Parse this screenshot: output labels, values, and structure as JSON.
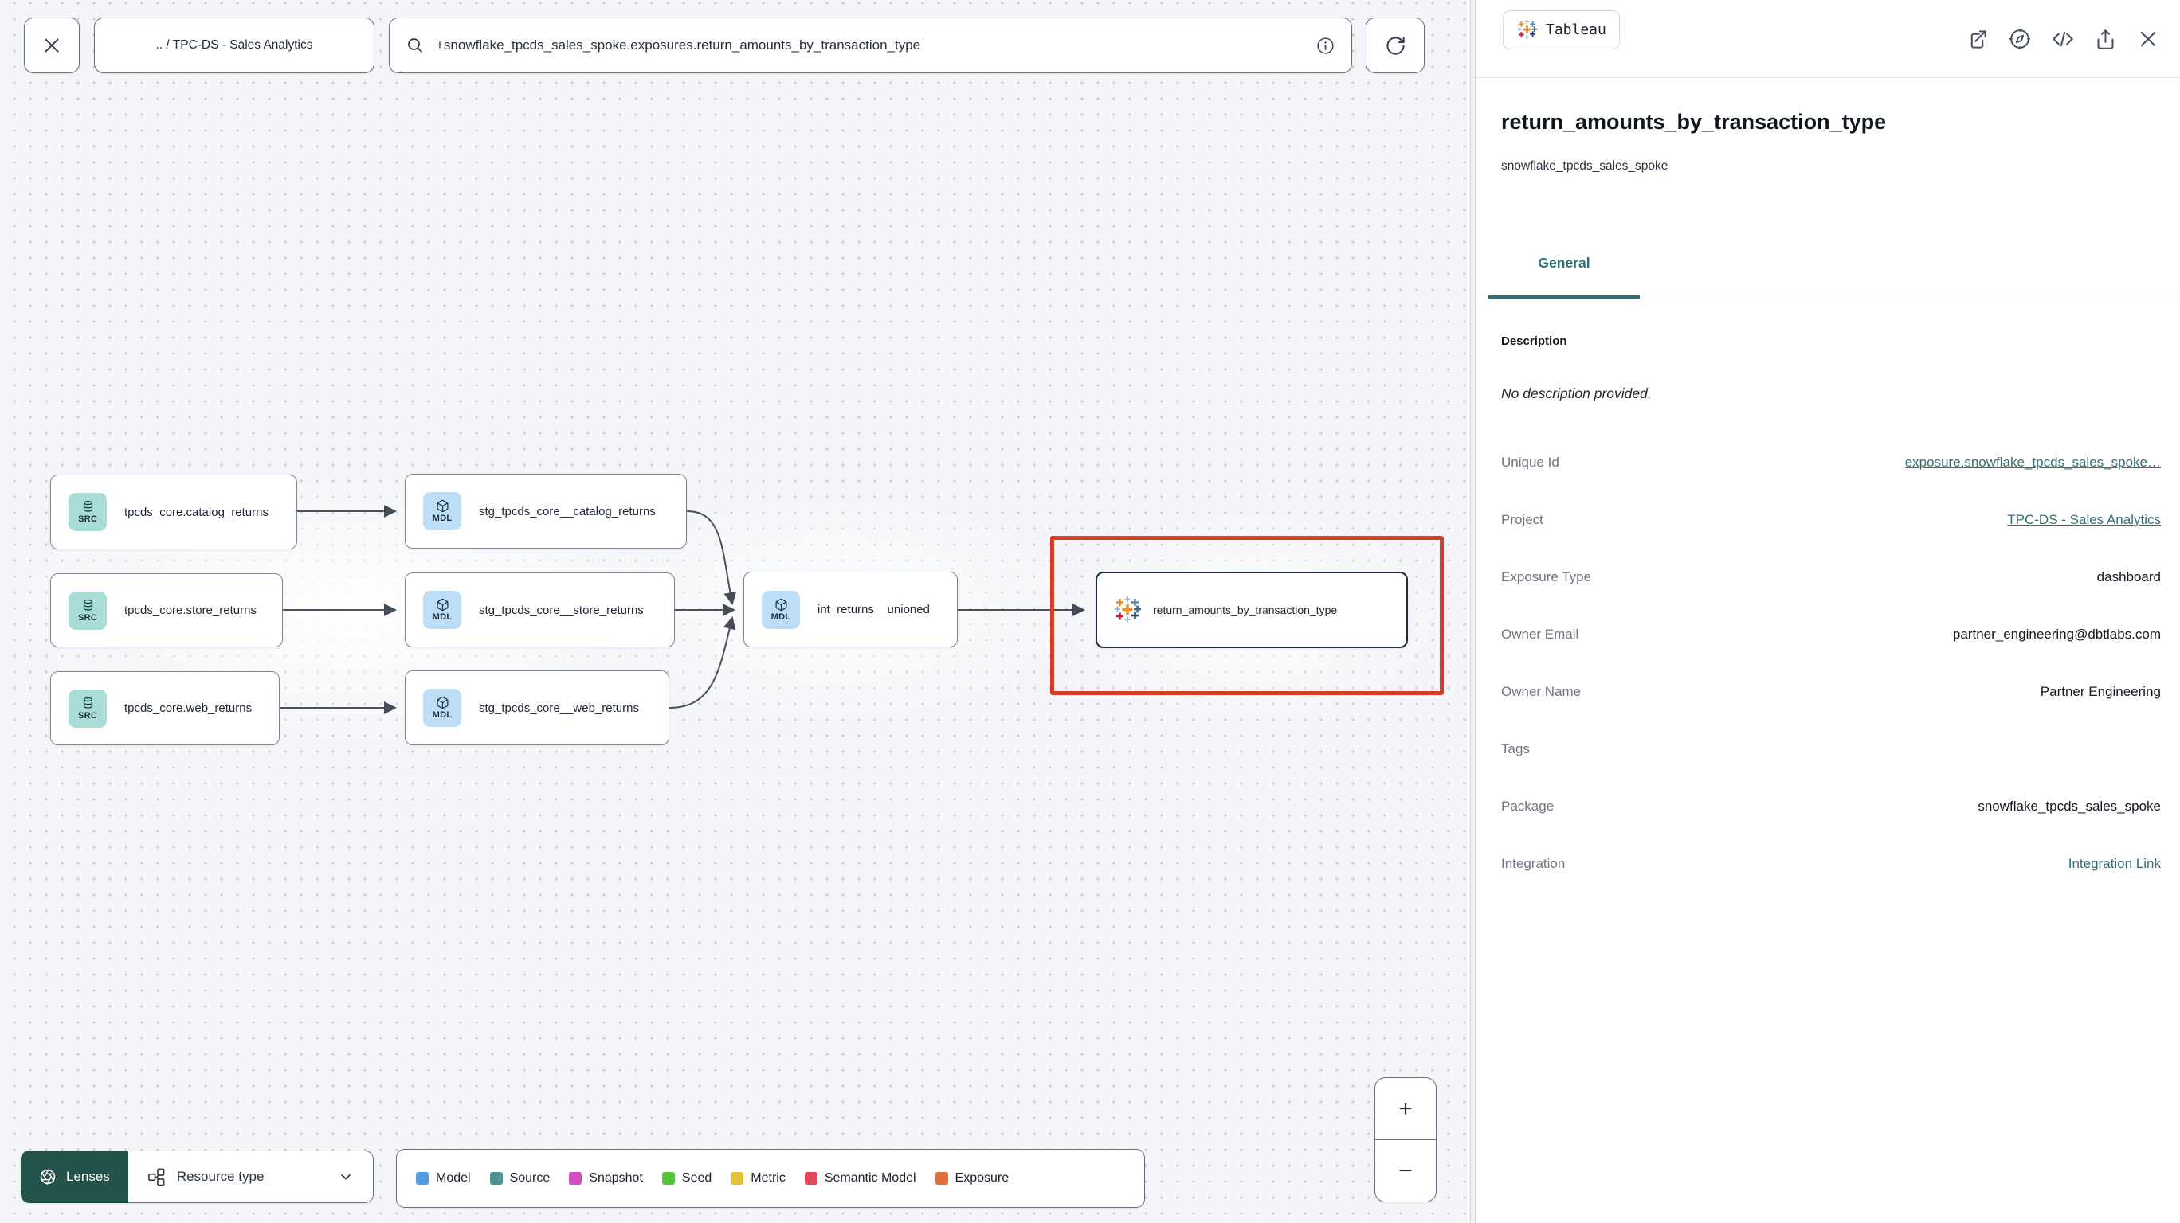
{
  "topbar": {
    "breadcrumb": ".. / TPC-DS - Sales Analytics",
    "search_value": "+snowflake_tpcds_sales_spoke.exposures.return_amounts_by_transaction_type"
  },
  "graph": {
    "nodes": [
      {
        "badge": "SRC",
        "label": "tpcds_core.catalog_returns"
      },
      {
        "badge": "SRC",
        "label": "tpcds_core.store_returns"
      },
      {
        "badge": "SRC",
        "label": "tpcds_core.web_returns"
      },
      {
        "badge": "MDL",
        "label": "stg_tpcds_core__catalog_returns"
      },
      {
        "badge": "MDL",
        "label": "stg_tpcds_core__store_returns"
      },
      {
        "badge": "MDL",
        "label": "stg_tpcds_core__web_returns"
      },
      {
        "badge": "MDL",
        "label": "int_returns__unioned"
      },
      {
        "badge": "tableau-icon",
        "label": "return_amounts_by_transaction_type"
      }
    ],
    "selection_highlight_color": "#d23e23"
  },
  "toolbar": {
    "lenses_label": "Lenses",
    "resource_type_label": "Resource type",
    "zoom_in_label": "+",
    "zoom_out_label": "−"
  },
  "legend": {
    "items": [
      {
        "label": "Model",
        "color": "#4f9ce1"
      },
      {
        "label": "Source",
        "color": "#4f918e"
      },
      {
        "label": "Snapshot",
        "color": "#d24ec1"
      },
      {
        "label": "Seed",
        "color": "#55c43c"
      },
      {
        "label": "Metric",
        "color": "#e2c23c"
      },
      {
        "label": "Semantic Model",
        "color": "#e2485c"
      },
      {
        "label": "Exposure",
        "color": "#e0713c"
      }
    ]
  },
  "panel": {
    "badge_label": "Tableau",
    "title": "return_amounts_by_transaction_type",
    "subtitle": "snowflake_tpcds_sales_spoke",
    "tab_label": "General",
    "accent_color": "#2e7175",
    "description_heading": "Description",
    "description_empty": "No description provided.",
    "fields": [
      {
        "label": "Unique Id",
        "value": "exposure.snowflake_tpcds_sales_spoke…",
        "link": true
      },
      {
        "label": "Project",
        "value": "TPC-DS - Sales Analytics",
        "link": true
      },
      {
        "label": "Exposure Type",
        "value": "dashboard",
        "link": false
      },
      {
        "label": "Owner Email",
        "value": "partner_engineering@dbtlabs.com",
        "link": false
      },
      {
        "label": "Owner Name",
        "value": "Partner Engineering",
        "link": false
      },
      {
        "label": "Tags",
        "value": "",
        "link": false
      },
      {
        "label": "Package",
        "value": "snowflake_tpcds_sales_spoke",
        "link": false
      },
      {
        "label": "Integration",
        "value": "Integration Link",
        "link": true
      }
    ]
  }
}
